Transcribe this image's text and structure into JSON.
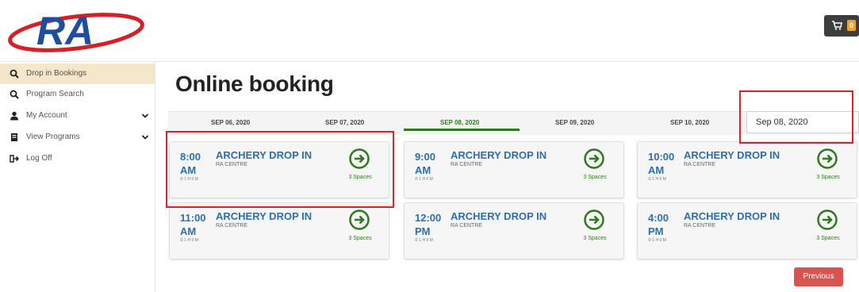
{
  "header": {
    "logo_text": "RA",
    "cart_count": "0"
  },
  "sidebar": {
    "items": [
      {
        "label": "Drop in Bookings",
        "icon": "search-icon"
      },
      {
        "label": "Program Search",
        "icon": "search-icon"
      },
      {
        "label": "My Account",
        "icon": "user-icon"
      },
      {
        "label": "View Programs",
        "icon": "book-icon"
      },
      {
        "label": "Log Off",
        "icon": "sign-out-icon"
      }
    ]
  },
  "main": {
    "title": "Online booking",
    "dates": [
      "SEP 06, 2020",
      "SEP 07, 2020",
      "SEP 08, 2020",
      "SEP 09, 2020",
      "SEP 10, 2020"
    ],
    "active_date_index": 2,
    "date_input_value": "Sep 08, 2020",
    "cards": [
      {
        "time": "8:00 AM",
        "name": "ARCHERY DROP IN",
        "location": "RA CENTRE",
        "duration": "1 H 0 M",
        "spaces": "3 Spaces"
      },
      {
        "time": "9:00 AM",
        "name": "ARCHERY DROP IN",
        "location": "RA CENTRE",
        "duration": "1 H 0 M",
        "spaces": "3 Spaces"
      },
      {
        "time": "10:00 AM",
        "name": "ARCHERY DROP IN",
        "location": "RA CENTRE",
        "duration": "1 H 0 M",
        "spaces": "3 Spaces"
      },
      {
        "time": "11:00 AM",
        "name": "ARCHERY DROP IN",
        "location": "RA CENTRE",
        "duration": "1 H 0 M",
        "spaces": "3 Spaces"
      },
      {
        "time": "12:00 PM",
        "name": "ARCHERY DROP IN",
        "location": "RA CENTRE",
        "duration": "1 H 0 M",
        "spaces": "3 Spaces"
      },
      {
        "time": "4:00 PM",
        "name": "ARCHERY DROP IN",
        "location": "RA CENTRE",
        "duration": "1 H 0 M",
        "spaces": "3 Spaces"
      }
    ],
    "previous_label": "Previous"
  },
  "colors": {
    "accent_blue": "#2c6fb0",
    "accent_green": "#2e7a1f",
    "highlight_red": "#e0202a",
    "sidebar_active": "#f3e6c9",
    "button_red": "#d9534f"
  }
}
